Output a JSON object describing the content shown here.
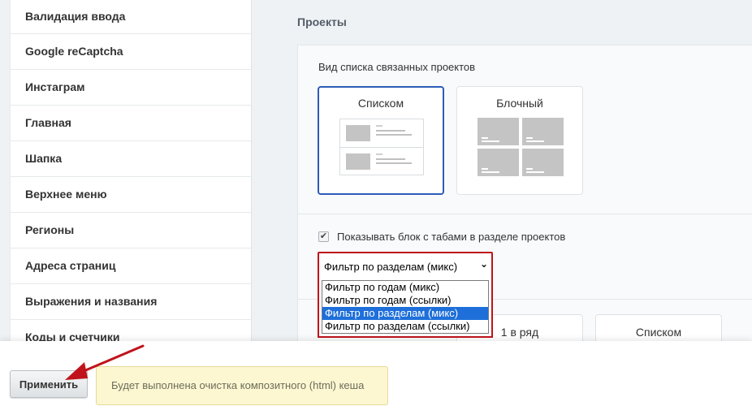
{
  "sidebar": {
    "items": [
      {
        "label": "Валидация ввода"
      },
      {
        "label": "Google reCaptcha"
      },
      {
        "label": "Инстаграм"
      },
      {
        "label": "Главная"
      },
      {
        "label": "Шапка"
      },
      {
        "label": "Верхнее меню"
      },
      {
        "label": "Регионы"
      },
      {
        "label": "Адреса страниц"
      },
      {
        "label": "Выражения и названия"
      },
      {
        "label": "Коды и счетчики"
      }
    ]
  },
  "main": {
    "section_title": "Проекты",
    "list_view_label": "Вид списка связанных проектов",
    "view_options": [
      {
        "label": "Списком",
        "selected": true
      },
      {
        "label": "Блочный",
        "selected": false
      }
    ],
    "show_tabs": {
      "label": "Показывать блок с табами в разделе проектов",
      "checked": true,
      "check_glyph": "✔"
    },
    "filter_select": {
      "value": "Фильтр по разделам (микс)",
      "arrow": "⌄",
      "options": [
        {
          "label": "Фильтр по годам (микс)",
          "active": false
        },
        {
          "label": "Фильтр по годам (ссылки)",
          "active": false
        },
        {
          "label": "Фильтр по разделам (микс)",
          "active": true
        },
        {
          "label": "Фильтр по разделам (ссылки)",
          "active": false
        }
      ]
    },
    "layout_options": [
      {
        "label": "1 в ряд"
      },
      {
        "label": "Списком"
      }
    ]
  },
  "footer": {
    "apply_label": "Применить",
    "notice": "Будет выполнена очистка композитного (html) кеша"
  },
  "colors": {
    "highlight_red": "#c0131b",
    "selected_blue": "#2e5cb8",
    "option_active": "#1e6fd9",
    "notice_bg": "#fcf7d1"
  }
}
